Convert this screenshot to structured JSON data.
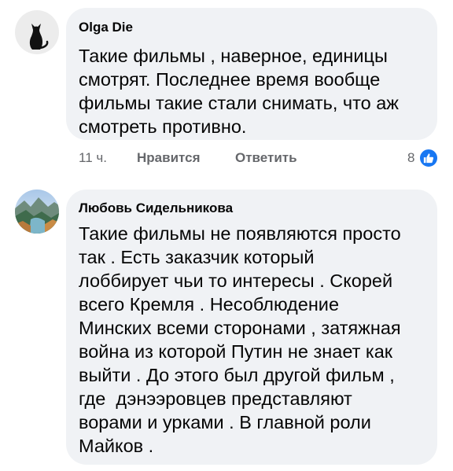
{
  "comments": [
    {
      "author": "Olga Die",
      "avatar_icon": "black-cat-icon",
      "text": "Такие фильмы , наверное, единицы\nсмотрят. Последнее время вообще\nфильмы такие стали снимать, что аж\nсмотреть противно.",
      "time": "11 ч.",
      "like_label": "Нравится",
      "reply_label": "Ответить",
      "reaction_count": "8",
      "reaction_icon": "like-thumb-icon",
      "reaction_color": "#1877f2"
    },
    {
      "author": "Любовь Сидельникова",
      "avatar_icon": "landscape-photo-icon",
      "text": "Такие фильмы не появляются просто\nтак . Есть заказчик который\nлоббирует чьи то интересы . Скорей\nвсего Кремля . Несоблюдение\nМинских всеми сторонами , затяжная\nвойна из которой Путин не знает как\nвыйти . До этого был другой фильм ,\nгде  дэнээровцев представляют\nворами и урками . В главной роли\nМайков ."
    }
  ],
  "colors": {
    "bubble_bg": "#f0f2f5",
    "text": "#050505",
    "meta_text": "#65676b",
    "accent": "#1877f2"
  }
}
